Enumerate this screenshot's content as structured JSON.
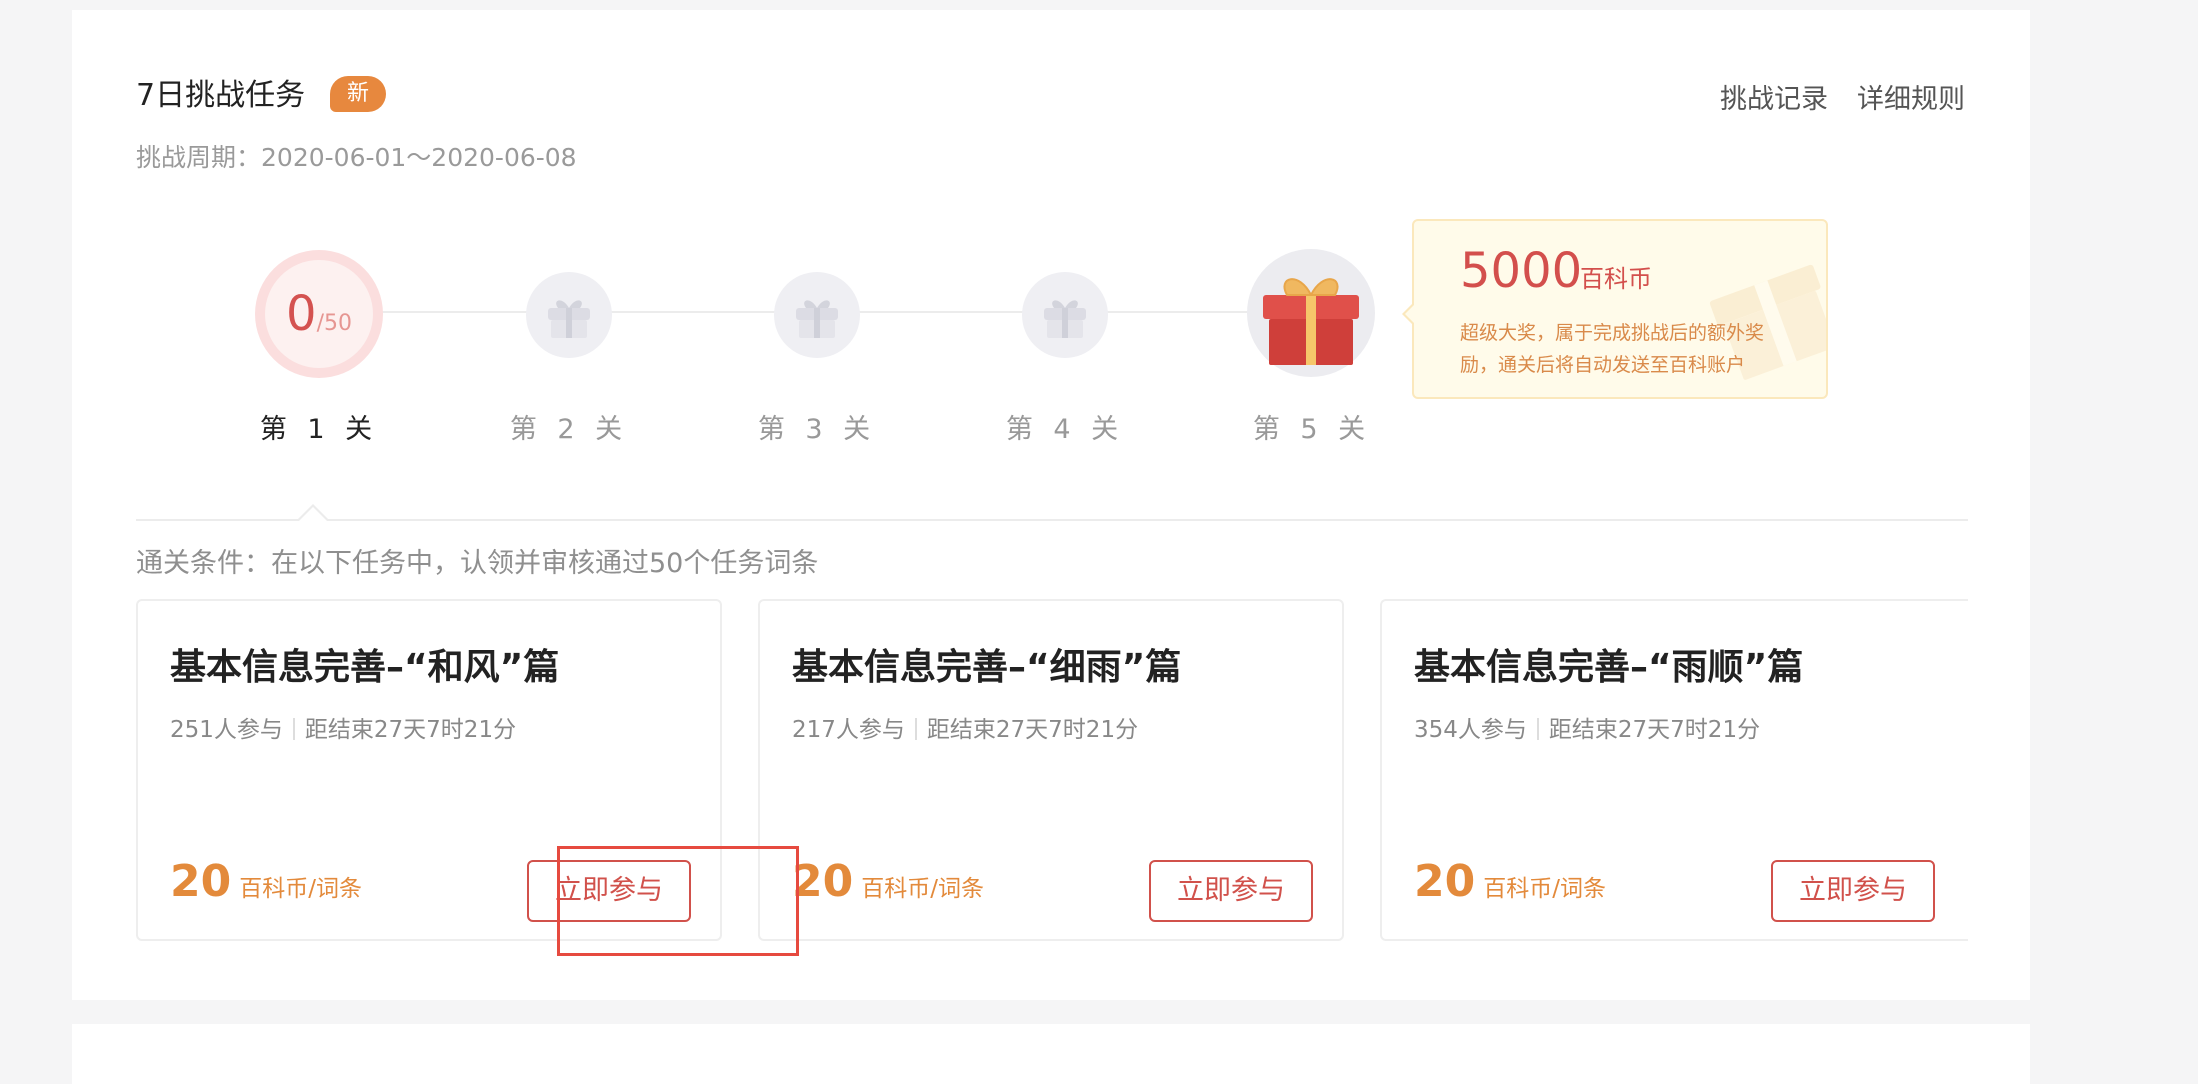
{
  "header": {
    "title": "7日挑战任务",
    "badge": "新",
    "period_label": "挑战周期：",
    "period_value": "2020-06-01～2020-06-08",
    "links": {
      "record": "挑战记录",
      "rules": "详细规则"
    }
  },
  "progress": {
    "current": "0",
    "total": "/50",
    "levels": [
      {
        "label": "第 1 关",
        "icon": "progress-ring"
      },
      {
        "label": "第 2 关",
        "icon": "gift-icon"
      },
      {
        "label": "第 3 关",
        "icon": "gift-icon"
      },
      {
        "label": "第 4 关",
        "icon": "gift-icon"
      },
      {
        "label": "第 5 关",
        "icon": "big-gift-icon"
      }
    ]
  },
  "grand_prize": {
    "amount": "5000",
    "unit": "百科币",
    "description": "超级大奖，属于完成挑战后的额外奖励，通关后将自动发送至百科账户"
  },
  "condition": "通关条件：在以下任务中，认领并审核通过50个任务词条",
  "tasks": [
    {
      "title": "基本信息完善–“和风”篇",
      "participants": "251人参与",
      "deadline": "距结束27天7时21分",
      "reward": "20",
      "reward_unit": "百科币/词条",
      "button": "立即参与"
    },
    {
      "title": "基本信息完善–“细雨”篇",
      "participants": "217人参与",
      "deadline": "距结束27天7时21分",
      "reward": "20",
      "reward_unit": "百科币/词条",
      "button": "立即参与"
    },
    {
      "title": "基本信息完善–“雨顺”篇",
      "participants": "354人参与",
      "deadline": "距结束27天7时21分",
      "reward": "20",
      "reward_unit": "百科币/词条",
      "button": "立即参与"
    }
  ],
  "colors": {
    "accent_red": "#d1514b",
    "accent_orange": "#e38a3b",
    "badge": "#e7883e",
    "highlight": "#e64a3f"
  }
}
